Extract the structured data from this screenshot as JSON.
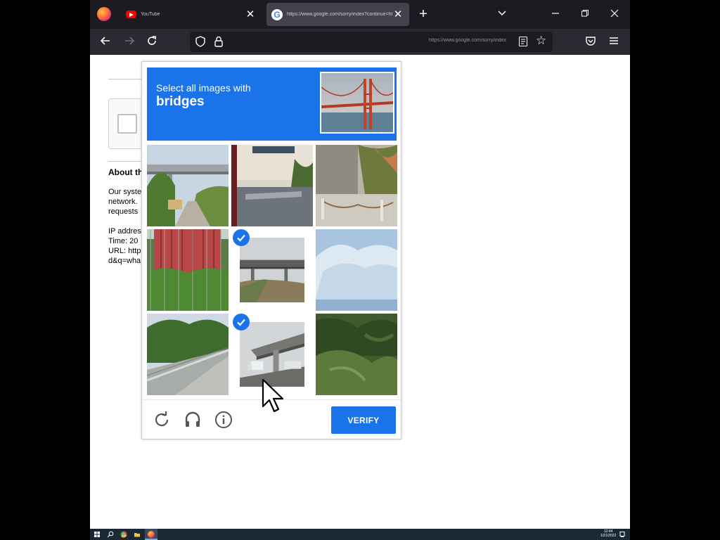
{
  "browser": {
    "tabs": [
      {
        "title": "YouTube",
        "favicon": "youtube-icon",
        "active": false
      },
      {
        "title": "https://www.google.com/sorry/index?continue=https://www.google.com/search",
        "favicon": "google-icon",
        "active": true
      }
    ],
    "url": "https://www.google.com/sorry/index"
  },
  "page": {
    "about_heading": "About th",
    "about_text": "Our syste\nnetwork.\nrequests",
    "info_text": "IP addres\nTime: 20\nURL: http\nd&q=wha"
  },
  "captcha": {
    "instruction": "Select all images with",
    "target": "bridges",
    "accent_color": "#1a73e8",
    "tiles": [
      {
        "index": 0,
        "selected": false,
        "content": "overpass over a path with trees"
      },
      {
        "index": 1,
        "selected": false,
        "content": "building with parking lot"
      },
      {
        "index": 2,
        "selected": false,
        "content": "building with chain fence"
      },
      {
        "index": 3,
        "selected": false,
        "content": "red container behind fence"
      },
      {
        "index": 4,
        "selected": true,
        "content": "highway overpass"
      },
      {
        "index": 5,
        "selected": false,
        "content": "snowy landscape"
      },
      {
        "index": 6,
        "selected": false,
        "content": "road with guardrail"
      },
      {
        "index": 7,
        "selected": true,
        "content": "overpass with truck"
      },
      {
        "index": 8,
        "selected": false,
        "content": "dense green bushes"
      }
    ],
    "verify_label": "VERIFY"
  },
  "taskbar": {
    "time": "12:44",
    "date": "1/21/2022"
  }
}
